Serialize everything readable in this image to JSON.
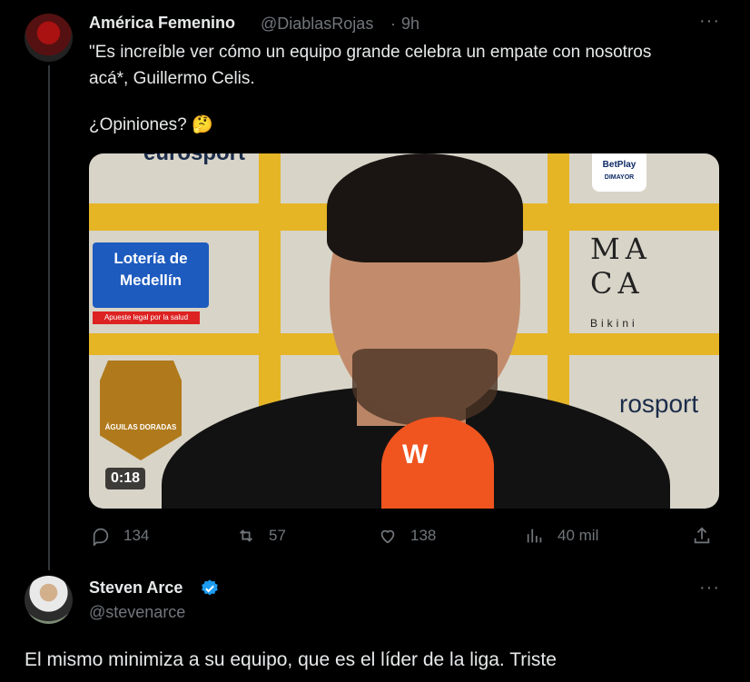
{
  "tweet1": {
    "author_name": "América Femenino",
    "handle": "@DiablasRojas",
    "separator": "·",
    "time": "9h",
    "text_line1": "\"Es increíble ver cómo un equipo grande celebra un empate con nosotros",
    "text_line2": "acá*, Guillermo Celis.",
    "text_line3": "¿Opiniones? 🤔",
    "video": {
      "duration": "0:18",
      "sponsor_loteria": "Lotería de Medellín",
      "loteria_tag": "Apueste legal por la salud",
      "shield_text": "ÁGUILAS DORADAS",
      "maca_line1": "MA",
      "maca_line2": "CA",
      "bikini": "Bikini",
      "betplay": "BetPlay",
      "betplay_sub": "DIMAYOR",
      "sport_text1": "eurosport",
      "sport_text2": "rosport",
      "mic_text": "W"
    },
    "actions": {
      "replies": "134",
      "retweets": "57",
      "likes": "138",
      "views": "40 mil"
    },
    "more_icon": "more-icon"
  },
  "tweet2": {
    "author_name": "Steven Arce",
    "handle": "@stevenarce",
    "verified": true,
    "verified_color": "#1d9bf0",
    "text": "El mismo minimiza a su equipo, que es el líder de la liga. Triste"
  },
  "colors": {
    "background": "#000000",
    "text_primary": "#e7e9ea",
    "text_secondary": "#71767b"
  }
}
